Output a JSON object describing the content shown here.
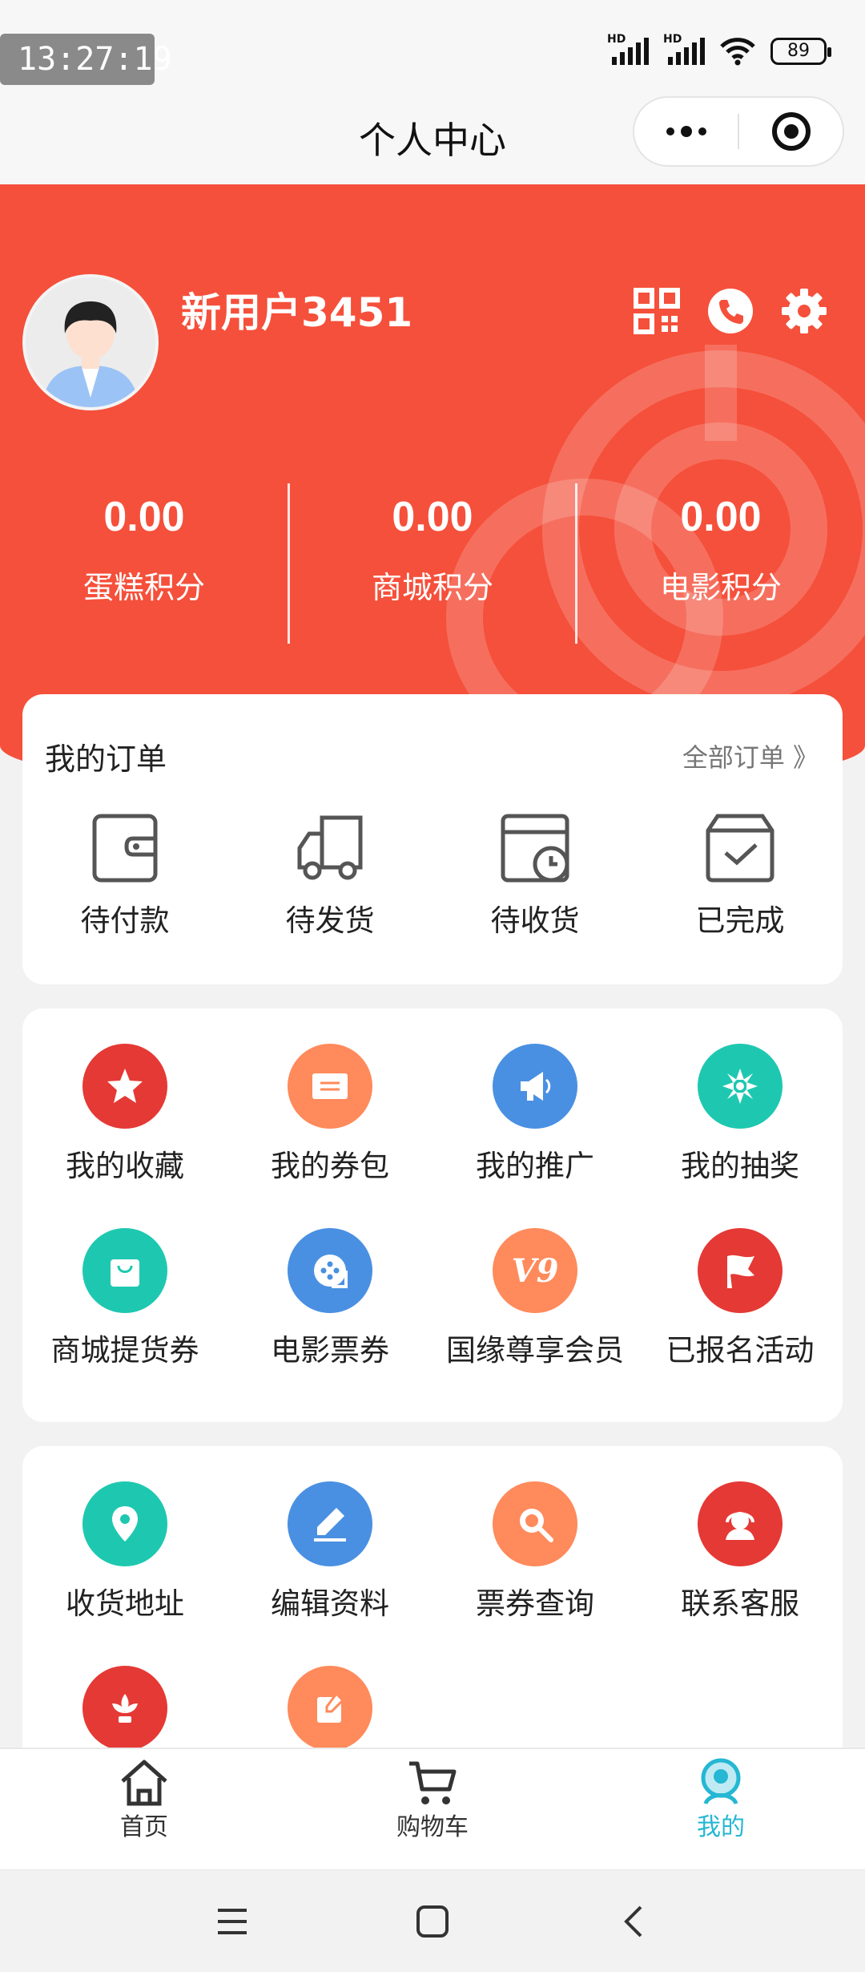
{
  "status_bar": {
    "time": "13:27:19",
    "network_1": "HD",
    "network_2": "HD",
    "battery": "89"
  },
  "nav": {
    "title": "个人中心"
  },
  "profile": {
    "username": "新用户3451"
  },
  "stats": [
    {
      "value": "0.00",
      "label": "蛋糕积分"
    },
    {
      "value": "0.00",
      "label": "商城积分"
    },
    {
      "value": "0.00",
      "label": "电影积分"
    }
  ],
  "orders": {
    "title": "我的订单",
    "all_label": "全部订单 》",
    "items": [
      {
        "label": "待付款",
        "icon": "wallet-icon"
      },
      {
        "label": "待发货",
        "icon": "truck-icon"
      },
      {
        "label": "待收货",
        "icon": "calendar-clock-icon"
      },
      {
        "label": "已完成",
        "icon": "box-check-icon"
      }
    ]
  },
  "services": {
    "items": [
      {
        "label": "我的收藏",
        "icon": "star-icon",
        "color": "#e53935"
      },
      {
        "label": "我的券包",
        "icon": "ticket-icon",
        "color": "#ff8a5b"
      },
      {
        "label": "我的推广",
        "icon": "megaphone-icon",
        "color": "#4a90e2"
      },
      {
        "label": "我的抽奖",
        "icon": "pinwheel-icon",
        "color": "#1ec8b0"
      },
      {
        "label": "商城提货券",
        "icon": "shopping-bag-icon",
        "color": "#1ec8b0"
      },
      {
        "label": "电影票券",
        "icon": "film-reel-icon",
        "color": "#4a90e2"
      },
      {
        "label": "国缘尊享会员",
        "icon": "v9-badge-icon",
        "badge": "V9",
        "color": "#ff8a5b"
      },
      {
        "label": "已报名活动",
        "icon": "flag-icon",
        "color": "#e53935"
      }
    ]
  },
  "tools": {
    "items": [
      {
        "label": "收货地址",
        "icon": "location-pin-icon",
        "color": "#1ec8b0"
      },
      {
        "label": "编辑资料",
        "icon": "pen-icon",
        "color": "#4a90e2"
      },
      {
        "label": "票券查询",
        "icon": "magnifier-icon",
        "color": "#ff8a5b"
      },
      {
        "label": "联系客服",
        "icon": "headset-icon",
        "color": "#e53935"
      },
      {
        "label": "",
        "icon": "flower-icon",
        "color": "#e53935"
      },
      {
        "label": "",
        "icon": "edit-note-icon",
        "color": "#ff8a5b"
      }
    ]
  },
  "tabbar": {
    "items": [
      {
        "label": "首页",
        "icon": "home-icon"
      },
      {
        "label": "购物车",
        "icon": "cart-icon"
      },
      {
        "label": "我的",
        "icon": "profile-icon",
        "active": true
      }
    ]
  },
  "colors": {
    "brand_red": "#f5503b",
    "active_tab": "#25b7d3"
  }
}
